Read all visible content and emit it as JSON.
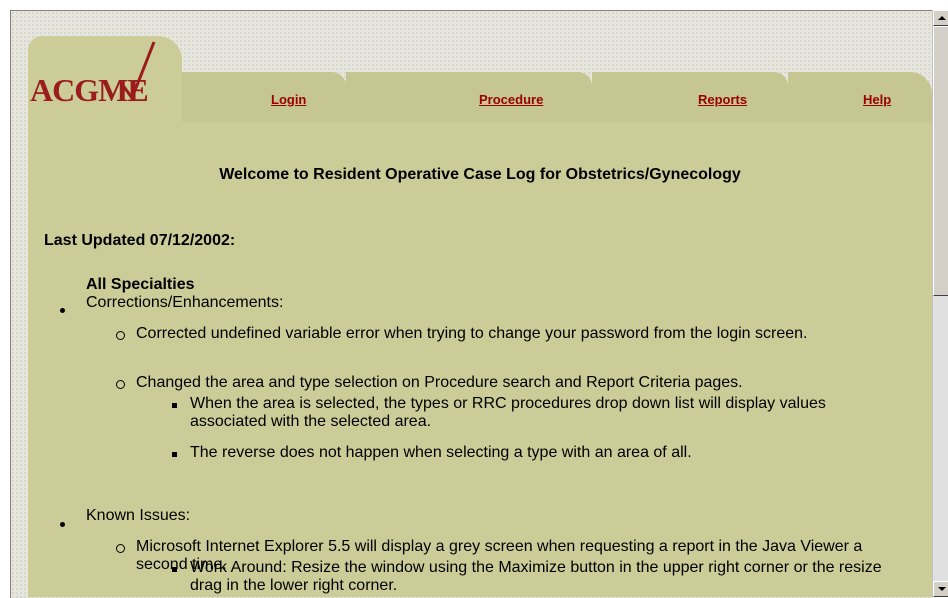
{
  "logo": {
    "text": "ACGME"
  },
  "nav": {
    "login": "Login",
    "procedure": "Procedure",
    "reports": "Reports",
    "help": "Help"
  },
  "title": "Welcome to Resident Operative Case Log for Obstetrics/Gynecology",
  "last_updated": "Last Updated 07/12/2002:",
  "section_heading": "All Specialties",
  "items": {
    "corrections": {
      "label": "Corrections/Enhancements:",
      "sub1": "Corrected undefined variable error when trying to change your password from the login screen.",
      "sub2": "Changed the area and type selection on Procedure search and Report Criteria pages.",
      "sub2a": "When the area is selected, the types or RRC procedures drop down list will display values associated with the selected area.",
      "sub2b": "The reverse does not happen when selecting a type with an area of all."
    },
    "known": {
      "label": "Known Issues:",
      "sub1": "Microsoft Internet Explorer 5.5 will display a grey screen when requesting a report in the Java Viewer a second time.",
      "sub1a": "Work Around: Resize the window using the Maximize button in the upper right corner or the resize drag in the lower right corner."
    }
  },
  "colors": {
    "panel": "#cccc99",
    "link": "#990000",
    "logo": "#9a1c1c"
  }
}
